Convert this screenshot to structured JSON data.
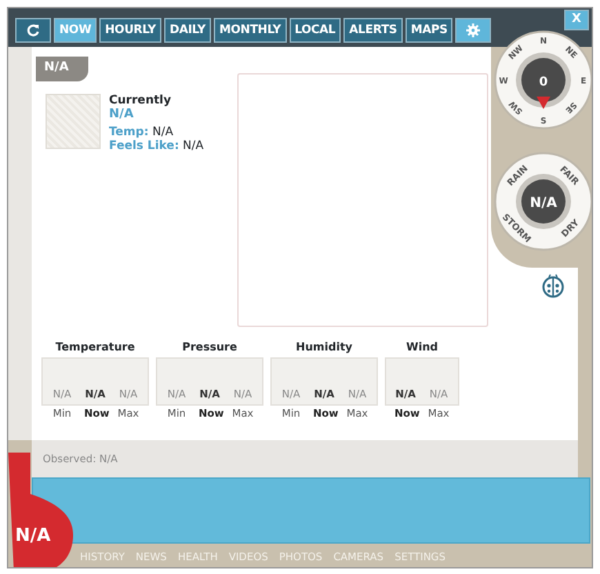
{
  "close_button": "X",
  "tabs": [
    {
      "kind": "refresh",
      "selected": false
    },
    {
      "kind": "text",
      "label": "NOW",
      "selected": true
    },
    {
      "kind": "text",
      "label": "HOURLY",
      "selected": false
    },
    {
      "kind": "text",
      "label": "DAILY",
      "selected": false
    },
    {
      "kind": "text",
      "label": "MONTHLY",
      "selected": false
    },
    {
      "kind": "text",
      "label": "LOCAL",
      "selected": false
    },
    {
      "kind": "text",
      "label": "ALERTS",
      "selected": false
    },
    {
      "kind": "text",
      "label": "MAPS",
      "selected": false
    },
    {
      "kind": "settings",
      "selected": false
    }
  ],
  "location": "N/A",
  "current": {
    "heading": "Currently",
    "condition": "N/A",
    "temp_label": "Temp:",
    "temp": "N/A",
    "feels_label": "Feels Like:",
    "feels": "N/A"
  },
  "compass": {
    "labels": [
      "N",
      "NE",
      "E",
      "SE",
      "S",
      "SW",
      "W",
      "NW"
    ],
    "value": "0"
  },
  "forecast_dial": {
    "labels": [
      "RAIN",
      "FAIR",
      "DRY",
      "STORM"
    ],
    "value": "N/A"
  },
  "stats": [
    {
      "title": "Temperature",
      "readings": [
        {
          "value": "N/A",
          "label": "Min",
          "current": false
        },
        {
          "value": "N/A",
          "label": "Now",
          "current": true
        },
        {
          "value": "N/A",
          "label": "Max",
          "current": false
        }
      ]
    },
    {
      "title": "Pressure",
      "readings": [
        {
          "value": "N/A",
          "label": "Min",
          "current": false
        },
        {
          "value": "N/A",
          "label": "Now",
          "current": true
        },
        {
          "value": "N/A",
          "label": "Max",
          "current": false
        }
      ]
    },
    {
      "title": "Humidity",
      "readings": [
        {
          "value": "N/A",
          "label": "Min",
          "current": false
        },
        {
          "value": "N/A",
          "label": "Now",
          "current": true
        },
        {
          "value": "N/A",
          "label": "Max",
          "current": false
        }
      ]
    },
    {
      "title": "Wind",
      "readings": [
        {
          "value": "N/A",
          "label": "Now",
          "current": true
        },
        {
          "value": "N/A",
          "label": "Max",
          "current": false
        }
      ]
    }
  ],
  "observed": "Observed: N/A",
  "thermometer": "N/A",
  "nav": [
    "HISTORY",
    "NEWS",
    "HEALTH",
    "VIDEOS",
    "PHOTOS",
    "CAMERAS",
    "SETTINGS"
  ]
}
